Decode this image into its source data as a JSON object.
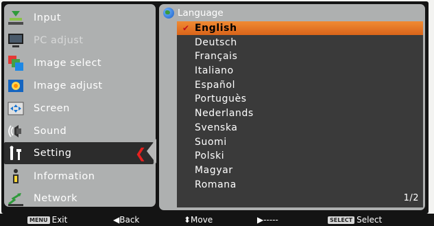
{
  "menu": {
    "items": [
      {
        "label": "Input",
        "icon": "input-icon",
        "disabled": false
      },
      {
        "label": "PC adjust",
        "icon": "pc-adjust-icon",
        "disabled": true
      },
      {
        "label": "Image select",
        "icon": "image-select-icon",
        "disabled": false
      },
      {
        "label": "Image adjust",
        "icon": "image-adjust-icon",
        "disabled": false
      },
      {
        "label": "Screen",
        "icon": "screen-icon",
        "disabled": false
      },
      {
        "label": "Sound",
        "icon": "sound-icon",
        "disabled": false
      },
      {
        "label": "Setting",
        "icon": "setting-icon",
        "disabled": false,
        "selected": true
      },
      {
        "label": "Information",
        "icon": "information-icon",
        "disabled": false
      },
      {
        "label": "Network",
        "icon": "network-icon",
        "disabled": false
      }
    ]
  },
  "panel": {
    "title": "Language",
    "selected": "English",
    "languages": [
      "English",
      "Deutsch",
      "Français",
      "Italiano",
      "Español",
      "Portuguès",
      "Nederlands",
      "Svenska",
      "Suomi",
      "Polski",
      "Magyar",
      "Romana"
    ],
    "page": "1/2"
  },
  "footer": {
    "exit_key": "MENU",
    "exit_label": "Exit",
    "back_label": "◀Back",
    "move_label": "⬍Move",
    "next_label": "▶-----",
    "select_key": "SELECT",
    "select_label": "Select"
  },
  "colors": {
    "panel_bg": "#aeb0b0",
    "list_bg": "#3a3a3a",
    "highlight": "#e8782a",
    "accent_red": "#e8201e"
  }
}
